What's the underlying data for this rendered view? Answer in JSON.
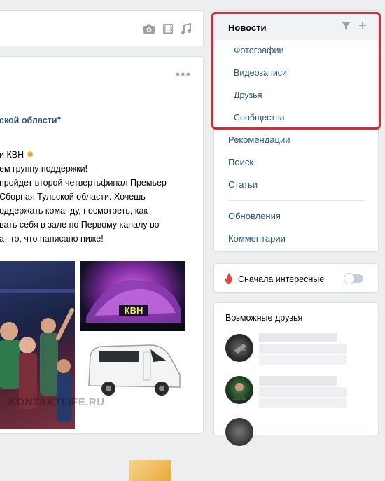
{
  "composer": {
    "icons": [
      "camera-icon",
      "film-icon",
      "music-icon"
    ]
  },
  "post": {
    "group_name": "ской области\"",
    "lines": [
      "и КВН",
      "ем группу поддержки!",
      "пройдет второй четвертьфинал Премьер",
      " Сборная Тульской области. Хочешь",
      "оддержать команду, посмотреть, как",
      "вать себя в зале по Первому каналу во",
      "ат то, что написано ниже!"
    ],
    "kvn_sign": "КВН",
    "watermark": "KONTAKTLIFE.RU"
  },
  "nav": {
    "head_label": "Новости",
    "sub_items": [
      "Фотографии",
      "Видеозаписи",
      "Друзья",
      "Сообщества"
    ],
    "links": [
      "Рекомендации",
      "Поиск",
      "Статьи"
    ],
    "links_after_divider": [
      "Обновления",
      "Комментарии"
    ]
  },
  "interesting": {
    "label": "Сначала интересные",
    "toggle_on": false
  },
  "friends": {
    "title": "Возможные друзья"
  },
  "colors": {
    "accent_link": "#2a5885",
    "highlight_border": "#d12f36",
    "fire": "#e64646"
  }
}
